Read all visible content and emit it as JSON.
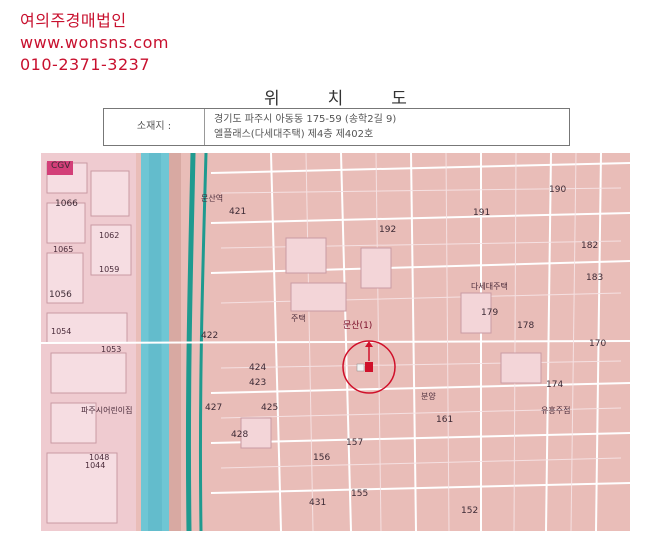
{
  "brand": {
    "name": "여의주경매법인",
    "website": "www.wonsns.com",
    "phone": "010-2371-3237"
  },
  "document": {
    "title": "위치도",
    "address_label": "소재지 :",
    "address_line1": "경기도 파주시 아동동 175-59 (송학2길 9)",
    "address_line2": "엘플래스(다세대주택) 제4층 제402호"
  },
  "map": {
    "subject_label": "문산(1)",
    "labels": [
      "CGV",
      "1066",
      "1065",
      "1062",
      "1059",
      "1056",
      "1054",
      "1053",
      "1048",
      "1044",
      "421",
      "422",
      "423",
      "424",
      "425",
      "427",
      "428",
      "178",
      "179",
      "182",
      "183",
      "190",
      "191",
      "192",
      "174",
      "170",
      "161",
      "157",
      "156",
      "155",
      "431",
      "152",
      "문산역",
      "주택",
      "파주시어린이집",
      "다세대주택",
      "유흥주점",
      "분양"
    ],
    "colors": {
      "brand_text": "#c8102e",
      "map_background": "#e9bdb8",
      "river": "#6fc6d4",
      "rail": "#1f9a8f",
      "subject_marker": "#d0102a"
    }
  }
}
